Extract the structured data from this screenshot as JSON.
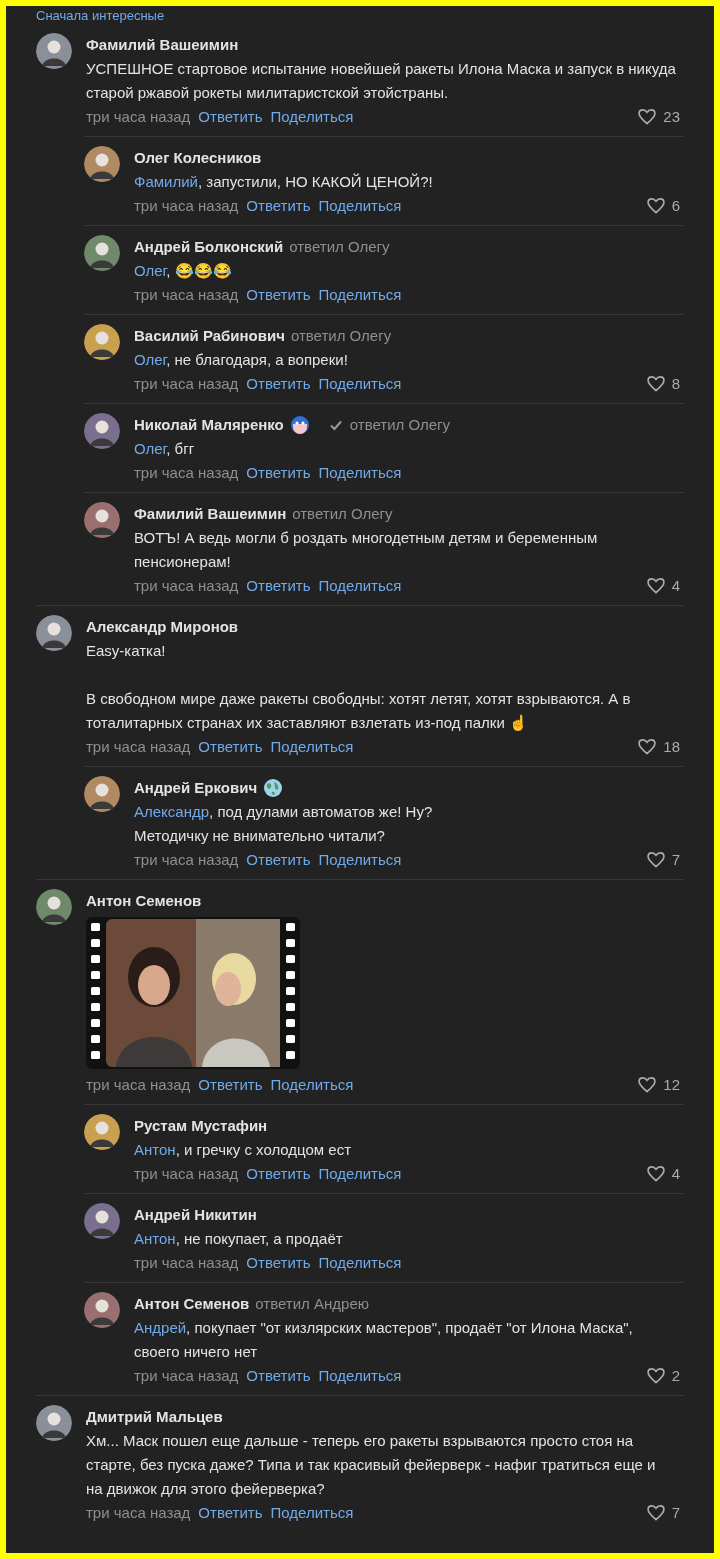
{
  "sort_label": "Сначала интересные",
  "threads": [
    {
      "comment": {
        "author": "Фамилий Вашеимин",
        "paragraphs": [
          "УСПЕШНОЕ стартовое испытание новейшей ракеты Илона Маска и запуск в никуда старой ржавой рокеты милитаристской этойстраны."
        ],
        "time": "три часа назад",
        "reply": "Ответить",
        "share": "Поделиться",
        "likes": "23"
      },
      "replies": [
        {
          "author": "Олег Колесников",
          "mention": "Фамилий",
          "paragraphs": [
            ", запустили, НО КАКОЙ ЦЕНОЙ?!"
          ],
          "time": "три часа назад",
          "reply": "Ответить",
          "share": "Поделиться",
          "likes": "6"
        },
        {
          "author": "Андрей Болконский",
          "replied_to": "ответил Олегу",
          "mention": "Олег",
          "paragraphs": [
            ", 😂😂😂"
          ],
          "time": "три часа назад",
          "reply": "Ответить",
          "share": "Поделиться"
        },
        {
          "author": "Василий Рабинович",
          "replied_to": "ответил Олегу",
          "mention": "Олег",
          "paragraphs": [
            ", не благодаря, а вопреки!"
          ],
          "time": "три часа назад",
          "reply": "Ответить",
          "share": "Поделиться",
          "likes": "8"
        },
        {
          "author": "Николай Маляренко",
          "badges": [
            {
              "kind": "mask"
            },
            {
              "kind": "check"
            }
          ],
          "replied_to": "ответил Олегу",
          "mention": "Олег",
          "paragraphs": [
            ", бгг"
          ],
          "time": "три часа назад",
          "reply": "Ответить",
          "share": "Поделиться"
        },
        {
          "author": "Фамилий Вашеимин",
          "replied_to": "ответил Олегу",
          "paragraphs": [
            "ВОТЪ! А ведь могли б роздать многодетным детям и беременным пенсионерам!"
          ],
          "time": "три часа назад",
          "reply": "Ответить",
          "share": "Поделиться",
          "likes": "4"
        }
      ]
    },
    {
      "comment": {
        "author": "Александр Миронов",
        "paragraphs": [
          "Easy-катка!",
          "В свободном мире даже ракеты свободны: хотят летят, хотят взрываются. А в тоталитарных странах их заставляют взлетать из-под палки ☝️"
        ],
        "time": "три часа назад",
        "reply": "Ответить",
        "share": "Поделиться",
        "likes": "18"
      },
      "replies": [
        {
          "author": "Андрей Еркович",
          "badges": [
            {
              "kind": "globe"
            }
          ],
          "mention": "Александр",
          "paragraphs": [
            ", под дулами автоматов же! Ну?\nМетодичку не внимательно читали?"
          ],
          "time": "три часа назад",
          "reply": "Ответить",
          "share": "Поделиться",
          "likes": "7"
        }
      ]
    },
    {
      "comment": {
        "author": "Антон Семенов",
        "time": "три часа назад",
        "reply": "Ответить",
        "share": "Поделиться",
        "likes": "12"
      },
      "replies": [
        {
          "author": "Рустам Мустафин",
          "mention": "Антон",
          "paragraphs": [
            ", и гречку с холодцом ест"
          ],
          "time": "три часа назад",
          "reply": "Ответить",
          "share": "Поделиться",
          "likes": "4"
        },
        {
          "author": "Андрей Никитин",
          "mention": "Антон",
          "paragraphs": [
            ", не покупает, а продаёт"
          ],
          "time": "три часа назад",
          "reply": "Ответить",
          "share": "Поделиться"
        },
        {
          "author": "Антон Семенов",
          "replied_to": "ответил Андрею",
          "mention": "Андрей",
          "paragraphs": [
            ", покупает \"от кизлярских мастеров\", продаёт \"от Илона Маска\", своего ничего нет"
          ],
          "time": "три часа назад",
          "reply": "Ответить",
          "share": "Поделиться",
          "likes": "2"
        }
      ]
    },
    {
      "comment": {
        "author": "Дмитрий Мальцев",
        "paragraphs": [
          "Хм... Маск пошел еще дальше - теперь его ракеты взрываются просто стоя на старте, без пуска даже? Типа и так красивый фейерверк - нафиг тратиться еще и на движок для этого фейерверка?"
        ],
        "time": "три часа назад",
        "reply": "Ответить",
        "share": "Поделиться",
        "likes": "7"
      }
    }
  ]
}
